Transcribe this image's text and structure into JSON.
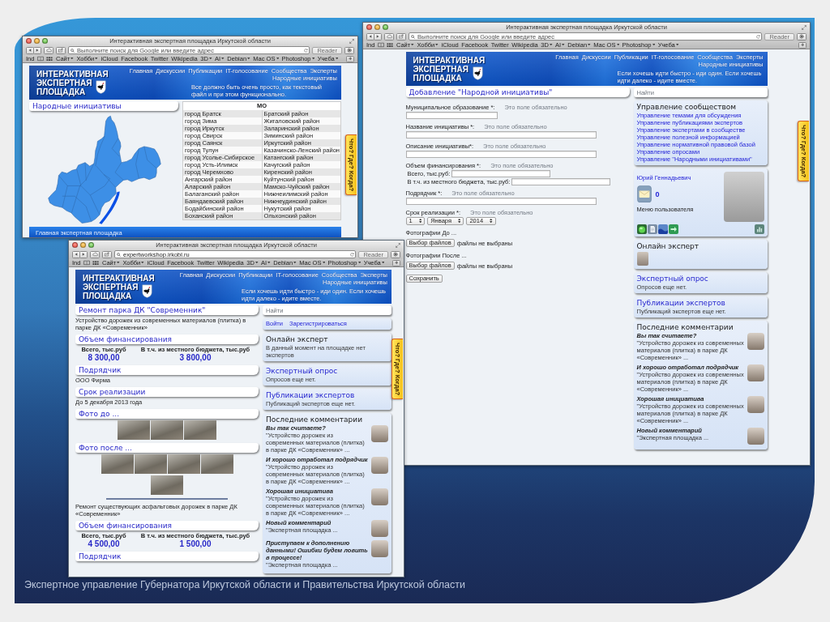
{
  "slide": {
    "caption": "Экспертное управление Губернатора Иркутской области и Правительства Иркутской области"
  },
  "windows": [
    {
      "kind": "map",
      "chrome": {
        "title": "Интерактивная экспертная площадка Иркутской области",
        "address": {
          "placeholder": "Выполните поиск для Google или введите адрес"
        },
        "reader": {
          "label": "Reader",
          "disabled": true
        },
        "bookmarks": [
          {
            "kind": "link",
            "label": "Ind"
          },
          {
            "kind": "reading_list"
          },
          {
            "kind": "top_sites"
          },
          {
            "kind": "folder",
            "label": "Сайт"
          },
          {
            "kind": "folder",
            "label": "Хобби"
          },
          {
            "kind": "link",
            "label": "iCloud"
          },
          {
            "kind": "link",
            "label": "Facebook"
          },
          {
            "kind": "link",
            "label": "Twitter"
          },
          {
            "kind": "link",
            "label": "Wikipedia"
          },
          {
            "kind": "folder",
            "label": "3D"
          },
          {
            "kind": "folder",
            "label": "AI"
          },
          {
            "kind": "folder",
            "label": "Debian"
          },
          {
            "kind": "folder",
            "label": "Mac OS"
          },
          {
            "kind": "folder",
            "label": "Photoshop"
          },
          {
            "kind": "folder",
            "label": "Учеба"
          }
        ]
      },
      "site": {
        "logo": [
          "ИНТЕРАКТИВНАЯ",
          "ЭКСПЕРТНАЯ",
          "ПЛОЩАДКА"
        ],
        "nav": [
          "Главная",
          "Дискуссии",
          "Публикации",
          "IT-голосование",
          "Сообщества",
          "Эксперты",
          "Народные инициативы"
        ],
        "tagline": "Все должно быть очень просто, как текстовый файл и при этом функционально.",
        "side_tab": "Что? Где? Когда?",
        "footer": "Главная экспертная площадка"
      },
      "main": [
        {
          "kind": "heading",
          "text": "Народные инициативы"
        },
        {
          "kind": "map"
        }
      ],
      "side": [
        {
          "kind": "table",
          "heading": "МО",
          "rows": [
            "город Братск",
            "город Зима",
            "город Иркутск",
            "город Свирск",
            "город Саянск",
            "город Тулун",
            "город Усолье-Сибирское",
            "город Усть-Илимск",
            "город Черемхово",
            "Ангарский район",
            "Аларский район",
            "Балаганский район",
            "Баяндаевский район",
            "Бодайбинский район",
            "Боханский район",
            "Братский район",
            "Жигаловский район",
            "Заларинский район",
            "Зиминский район",
            "Иркутский район",
            "Казачинско-Ленский район",
            "Катангский район",
            "Качугский район",
            "Киренский район",
            "Куйтунский район",
            "Мамско-Чуйский район",
            "Нижнеилимский район",
            "Нижнеудинский район",
            "Нукутский район",
            "Ольхонский район"
          ]
        }
      ]
    },
    {
      "kind": "form",
      "chrome": {
        "title": "Интерактивная экспертная площадка Иркутской области",
        "address": {
          "placeholder": "Выполните поиск для Google или введите адрес"
        },
        "reader": {
          "label": "Reader",
          "disabled": true
        },
        "bookmarks": [
          {
            "kind": "link",
            "label": "Ind"
          },
          {
            "kind": "reading_list"
          },
          {
            "kind": "top_sites"
          },
          {
            "kind": "folder",
            "label": "Сайт"
          },
          {
            "kind": "folder",
            "label": "Хобби"
          },
          {
            "kind": "link",
            "label": "iCloud"
          },
          {
            "kind": "link",
            "label": "Facebook"
          },
          {
            "kind": "link",
            "label": "Twitter"
          },
          {
            "kind": "link",
            "label": "Wikipedia"
          },
          {
            "kind": "folder",
            "label": "3D"
          },
          {
            "kind": "folder",
            "label": "AI"
          },
          {
            "kind": "folder",
            "label": "Debian"
          },
          {
            "kind": "folder",
            "label": "Mac OS"
          },
          {
            "kind": "folder",
            "label": "Photoshop"
          },
          {
            "kind": "folder",
            "label": "Учеба"
          }
        ]
      },
      "site": {
        "logo": [
          "ИНТЕРАКТИВНАЯ",
          "ЭКСПЕРТНАЯ",
          "ПЛОЩАДКА"
        ],
        "nav": [
          "Главная",
          "Дискуссии",
          "Публикации",
          "IT-голосование",
          "Сообщества",
          "Эксперты",
          "Народные инициативы"
        ],
        "tagline": "Если хочешь идти быстро - иди один. Если хочешь идти далеко - идите вместе.",
        "side_tab": "Что? Где? Когда?"
      },
      "main": [
        {
          "kind": "heading",
          "text": "Добавление \"Народной инициативы\""
        },
        {
          "kind": "short_field",
          "label": "Муниципальное образование *:",
          "hint": "Это поле обязательно"
        },
        {
          "kind": "field",
          "label": "Название инициативы *:",
          "hint": "Это поле обязательно"
        },
        {
          "kind": "field",
          "label": "Описание инициативы*:",
          "hint": "Это поле обязательно"
        },
        {
          "kind": "money_fields",
          "label": "Объем финансирования *:",
          "hint": "Это поле обязательно",
          "inputs": [
            {
              "label": "Всего, тыс.руб:"
            },
            {
              "label": "В т.ч. из местного бюджета, тыс.руб:"
            }
          ]
        },
        {
          "kind": "field",
          "label": "Подрядчик *:",
          "hint": "Это поле обязательно"
        },
        {
          "kind": "date_field",
          "label": "Срок реализации *:",
          "hint": "Это поле обязательно",
          "selects": [
            "1",
            "Января",
            "2014"
          ]
        },
        {
          "kind": "file_field",
          "label": "Фотографии До ...",
          "button": "Выбор файлов",
          "status": "файлы не выбраны"
        },
        {
          "kind": "file_field",
          "label": "Фотографии После ...",
          "button": "Выбор файлов",
          "status": "файлы не выбраны"
        },
        {
          "kind": "submit",
          "button": "Сохранить"
        }
      ],
      "side": [
        {
          "kind": "search",
          "placeholder": "Найти"
        },
        {
          "kind": "links",
          "heading": "Управление сообществом",
          "links": [
            "Управление темами для обсуждения",
            "Управление публикациями экспертов",
            "Управление экспертами в сообществе",
            "Управление полезной информацией",
            "Управление нормативной правовой базой",
            "Управление опросами",
            "Управление \"Народными инициативами\""
          ]
        },
        {
          "kind": "user",
          "name": "Юрий Геннадьевич",
          "messages": "0",
          "menu_label": "Меню пользователя",
          "menu_icons": [
            {
              "kind": "globe"
            },
            {
              "kind": "document"
            },
            {
              "kind": "wave"
            },
            {
              "kind": "arrow"
            },
            {
              "kind": "chart"
            }
          ]
        },
        {
          "kind": "experts",
          "heading": "Онлайн эксперт",
          "experts": [
            {
              "kind": "photo"
            }
          ]
        },
        {
          "kind": "notice",
          "heading": "Экспертный опрос",
          "text": "Опросов еще нет."
        },
        {
          "kind": "notice",
          "heading": "Публикации экспертов",
          "text": "Публикаций экспертов еще нет."
        },
        {
          "kind": "comments",
          "heading": "Последние комментарии",
          "items": [
            {
              "title": "Вы так считаете?",
              "text": "\"Устройство дорожек из современных материалов (плитка) в парке ДК «Современник» ..."
            },
            {
              "title": "И хорошо отработал подрядчик",
              "text": "\"Устройство дорожек из современных материалов (плитка) в парке ДК «Современник» ..."
            },
            {
              "title": "Хорошая инициатива",
              "text": "\"Устройство дорожек из современных материалов (плитка) в парке ДК «Современник» ..."
            },
            {
              "title": "Новый комментарий",
              "text": "\"Экспертная площадка ..."
            }
          ]
        }
      ]
    },
    {
      "kind": "project",
      "chrome": {
        "title": "Интерактивная экспертная площадка Иркутской области",
        "address": {
          "value": "expertworkshop.irkobl.ru"
        },
        "reader": {
          "label": "Reader",
          "disabled": true
        },
        "bookmarks": [
          {
            "kind": "link",
            "label": "Ind"
          },
          {
            "kind": "reading_list"
          },
          {
            "kind": "top_sites"
          },
          {
            "kind": "folder",
            "label": "Сайт"
          },
          {
            "kind": "folder",
            "label": "Хобби"
          },
          {
            "kind": "link",
            "label": "iCloud"
          },
          {
            "kind": "link",
            "label": "Facebook"
          },
          {
            "kind": "link",
            "label": "Twitter"
          },
          {
            "kind": "link",
            "label": "Wikipedia"
          },
          {
            "kind": "folder",
            "label": "3D"
          },
          {
            "kind": "folder",
            "label": "AI"
          },
          {
            "kind": "folder",
            "label": "Debian"
          },
          {
            "kind": "folder",
            "label": "Mac OS"
          },
          {
            "kind": "folder",
            "label": "Photoshop"
          },
          {
            "kind": "folder",
            "label": "Учеба"
          }
        ]
      },
      "site": {
        "logo": [
          "ИНТЕРАКТИВНАЯ",
          "ЭКСПЕРТНАЯ",
          "ПЛОЩАДКА"
        ],
        "nav": [
          "Главная",
          "Дискуссии",
          "Публикации",
          "IT-голосование",
          "Сообщества",
          "Эксперты",
          "Народные инициативы"
        ],
        "tagline": "Если хочешь идти быстро - иди один. Если хочешь идти далеко - идите вместе.",
        "side_tab": "Что? Где? Когда?"
      },
      "main": [
        {
          "kind": "heading",
          "text": "Ремонт парка ДК \"Современник\""
        },
        {
          "kind": "paragraph",
          "text": "Устройство дорожек из современных материалов (плитка) в парке ДК «Современник»"
        },
        {
          "kind": "heading",
          "text": "Объем финансирования"
        },
        {
          "kind": "amounts",
          "items": [
            {
              "label": "Всего, тыс.руб",
              "value": "8 300,00"
            },
            {
              "label": "В т.ч. из местного бюджета, тыс.руб",
              "value": "3 800,00"
            }
          ]
        },
        {
          "kind": "heading",
          "text": "Подрядчик"
        },
        {
          "kind": "paragraph",
          "text": "ООО Фирма"
        },
        {
          "kind": "heading",
          "text": "Срок реализации"
        },
        {
          "kind": "paragraph",
          "text": "До 5 декабря 2013 года"
        },
        {
          "kind": "heading",
          "text": "Фото до ..."
        },
        {
          "kind": "photos",
          "photos": [
            {
              "kind": "photo"
            },
            {
              "kind": "photo"
            },
            {
              "kind": "photo"
            }
          ]
        },
        {
          "kind": "heading",
          "text": "Фото после ..."
        },
        {
          "kind": "photos",
          "photos": [
            {
              "kind": "photo"
            },
            {
              "kind": "photo"
            },
            {
              "kind": "photo"
            },
            {
              "kind": "photo"
            },
            {
              "kind": "photo"
            }
          ]
        },
        {
          "kind": "rule"
        },
        {
          "kind": "paragraph",
          "text": "Ремонт существующих асфальтовых дорожек в парке ДК «Современник»"
        },
        {
          "kind": "heading",
          "text": "Объем финансирования"
        },
        {
          "kind": "amounts",
          "items": [
            {
              "label": "Всего, тыс.руб",
              "value": "4 500,00"
            },
            {
              "label": "В т.ч. из местного бюджета, тыс.руб",
              "value": "1 500,00"
            }
          ]
        },
        {
          "kind": "heading",
          "text": "Подрядчик"
        }
      ],
      "side": [
        {
          "kind": "search",
          "placeholder": "Найти"
        },
        {
          "kind": "login",
          "links": [
            "Войти",
            "Зарегистрироваться"
          ]
        },
        {
          "kind": "experts",
          "heading": "Онлайн эксперт",
          "note": "В данный момент на площадке нет экспертов"
        },
        {
          "kind": "notice",
          "heading": "Экспертный опрос",
          "text": "Опросов еще нет."
        },
        {
          "kind": "notice",
          "heading": "Публикации экспертов",
          "text": "Публикаций экспертов еще нет."
        },
        {
          "kind": "comments",
          "heading": "Последние комментарии",
          "items": [
            {
              "title": "Вы так считаете?",
              "text": "\"Устройство дорожек из современных материалов (плитка) в парке ДК «Современник» ..."
            },
            {
              "title": "И хорошо отработал подрядчик",
              "text": "\"Устройство дорожек из современных материалов (плитка) в парке ДК «Современник» ..."
            },
            {
              "title": "Хорошая инициатива",
              "text": "\"Устройство дорожек из современных материалов (плитка) в парке ДК «Современник» ..."
            },
            {
              "title": "Новый комментарий",
              "text": "\"Экспертная площадка ..."
            },
            {
              "title": "Приступаем к дополнению данными! Ошибки будем ловить в процессе!",
              "text": "\"Экспертная площадка ..."
            }
          ]
        }
      ]
    }
  ]
}
